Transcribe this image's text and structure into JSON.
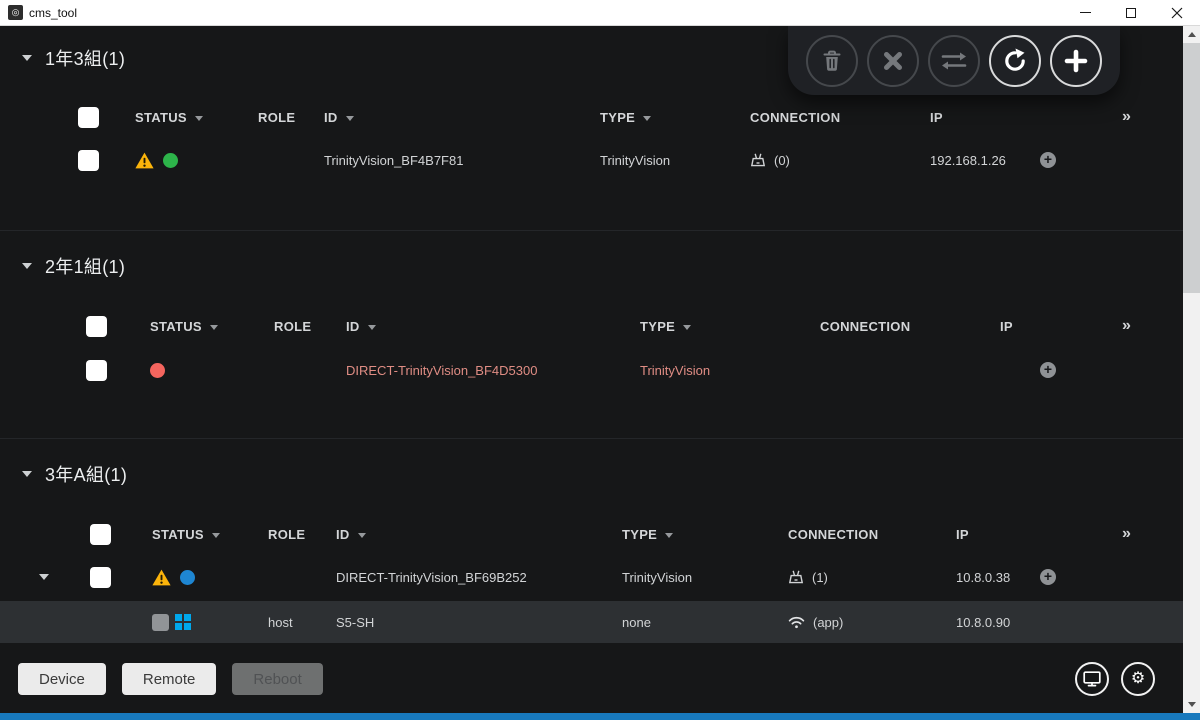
{
  "window": {
    "title": "cms_tool"
  },
  "toolbar": {
    "buttons": [
      {
        "icon": "trash-icon",
        "enabled": false
      },
      {
        "icon": "cancel-icon",
        "enabled": false
      },
      {
        "icon": "transfer-icon",
        "enabled": false
      },
      {
        "icon": "refresh-icon",
        "enabled": true
      },
      {
        "icon": "add-icon",
        "enabled": true
      }
    ]
  },
  "columns": {
    "status": "STATUS",
    "role": "ROLE",
    "id": "ID",
    "type": "TYPE",
    "connection": "CONNECTION",
    "ip": "IP",
    "more": "»"
  },
  "groups": [
    {
      "title": "1年3組(1)",
      "rows": [
        {
          "status": [
            "warning",
            "online"
          ],
          "role": "",
          "id": "TrinityVision_BF4B7F81",
          "type": "TrinityVision",
          "connection": "(0)",
          "ip": "192.168.1.26"
        }
      ]
    },
    {
      "title": "2年1組(1)",
      "rows": [
        {
          "status": [
            "error"
          ],
          "role": "",
          "id": "DIRECT-TrinityVision_BF4D5300",
          "type": "TrinityVision",
          "connection": "",
          "ip": ""
        }
      ]
    },
    {
      "title": "3年A組(1)",
      "rows": [
        {
          "status": [
            "warning",
            "direct"
          ],
          "role": "",
          "id": "DIRECT-TrinityVision_BF69B252",
          "type": "TrinityVision",
          "connection": "(1)",
          "ip": "10.8.0.38"
        }
      ],
      "subrow": {
        "role": "host",
        "id": "S5-SH",
        "type": "none",
        "connection": "(app)",
        "ip": "10.8.0.90"
      }
    }
  ],
  "footer": {
    "device": "Device",
    "remote": "Remote",
    "reboot": "Reboot"
  },
  "colors": {
    "warning": "#fbb40b",
    "online_green": "#2db44a",
    "error_red": "#f4655e",
    "direct_blue": "#1e86d2",
    "os_icon_cyan": "#00a8ec",
    "error_text": "#e08d84",
    "bottom_bar": "#1879bd",
    "background": "#161718",
    "subrow_background": "#2d3033"
  }
}
